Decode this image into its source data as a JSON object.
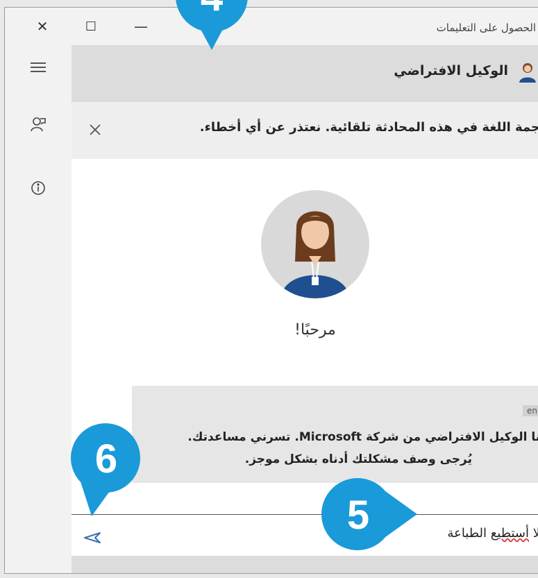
{
  "window": {
    "title": "الحصول على التعليمات",
    "close_glyph": "✕",
    "maximize_glyph": "☐",
    "minimize_glyph": "—"
  },
  "header": {
    "agent_name": "الوكيل الافتراضي"
  },
  "notice": {
    "text": "جمة اللغة في هذه المحادثة تلقائية. نعتذر عن أي أخطاء.",
    "close_glyph": "✕"
  },
  "sidebar": {
    "icons": [
      "menu-icon",
      "feedback-icon",
      "info-icon"
    ]
  },
  "chat": {
    "greeting": "مرحبًا!",
    "message": {
      "lang_tag": "en",
      "line1": "أنا الوكيل الافتراضي من شركة Microsoft. تسرني مساعدتك.",
      "line2": "يُرجى وصف مشكلتك أدناه بشكل موجز."
    }
  },
  "input": {
    "value_prefix": "لا ",
    "value_underlined": "أستطيع",
    "value_suffix": " الطباعة"
  },
  "callouts": {
    "top": "4",
    "send": "6",
    "input": "5",
    "color": "#1a9ad8"
  }
}
